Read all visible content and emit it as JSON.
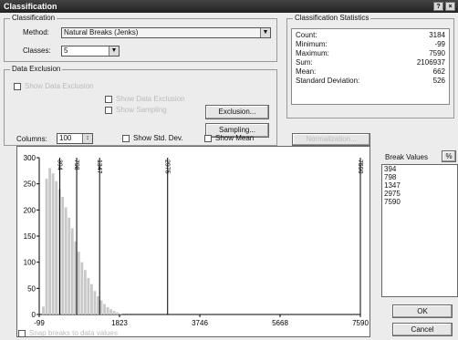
{
  "window": {
    "title": "Classification",
    "help": "?",
    "close": "×"
  },
  "classification": {
    "group_label": "Classification",
    "method_label": "Method:",
    "method_value": "Natural Breaks (Jenks)",
    "classes_label": "Classes:",
    "classes_value": "5"
  },
  "data_exclusion": {
    "group_label": "Data Exclusion",
    "show_excluded": "Show Data Exclusion",
    "opt_a": "Show Data Exclusion",
    "opt_b": "Show Sampling",
    "exclusion_button": "Exclusion...",
    "sampling_button": "Sampling..."
  },
  "statistics": {
    "group_label": "Classification Statistics",
    "rows": [
      {
        "name": "Count:",
        "value": "3184"
      },
      {
        "name": "Minimum:",
        "value": "-99"
      },
      {
        "name": "Maximum:",
        "value": "7590"
      },
      {
        "name": "Sum:",
        "value": "2106937"
      },
      {
        "name": "Mean:",
        "value": "662"
      },
      {
        "name": "Standard Deviation:",
        "value": "526"
      }
    ],
    "normalization_button": "Normalization..."
  },
  "toolbar": {
    "columns_label": "Columns:",
    "columns_value": "100",
    "show_std_dev": "Show Std. Dev.",
    "show_mean": "Show Mean"
  },
  "chart_data": {
    "type": "bar",
    "title": "",
    "xlabel": "",
    "ylabel": "",
    "x_ticks": [
      "-99",
      "1823",
      "3746",
      "5668",
      "7590"
    ],
    "y_ticks": [
      "0",
      "50",
      "100",
      "150",
      "200",
      "250",
      "300"
    ],
    "xlim": [
      -99,
      7590
    ],
    "ylim": [
      0,
      300
    ],
    "histogram": {
      "bin_centers": [
        0,
        77,
        154,
        231,
        308,
        385,
        462,
        539,
        616,
        693,
        770,
        847,
        924,
        1001,
        1078,
        1155,
        1232,
        1309,
        1386,
        1463,
        1540,
        1617,
        1694,
        1771,
        1848
      ],
      "counts": [
        15,
        260,
        280,
        270,
        255,
        240,
        225,
        205,
        185,
        165,
        140,
        120,
        100,
        85,
        70,
        58,
        45,
        35,
        27,
        20,
        14,
        10,
        7,
        4,
        2
      ]
    },
    "break_lines": [
      394,
      798,
      1347,
      2975,
      7590
    ]
  },
  "break_values": {
    "label": "Break Values",
    "percent_symbol": "%",
    "values": [
      "394",
      "798",
      "1347",
      "2975",
      "7590"
    ]
  },
  "footer": {
    "snap_label": "Snap breaks to data values",
    "ok": "OK",
    "cancel": "Cancel"
  }
}
